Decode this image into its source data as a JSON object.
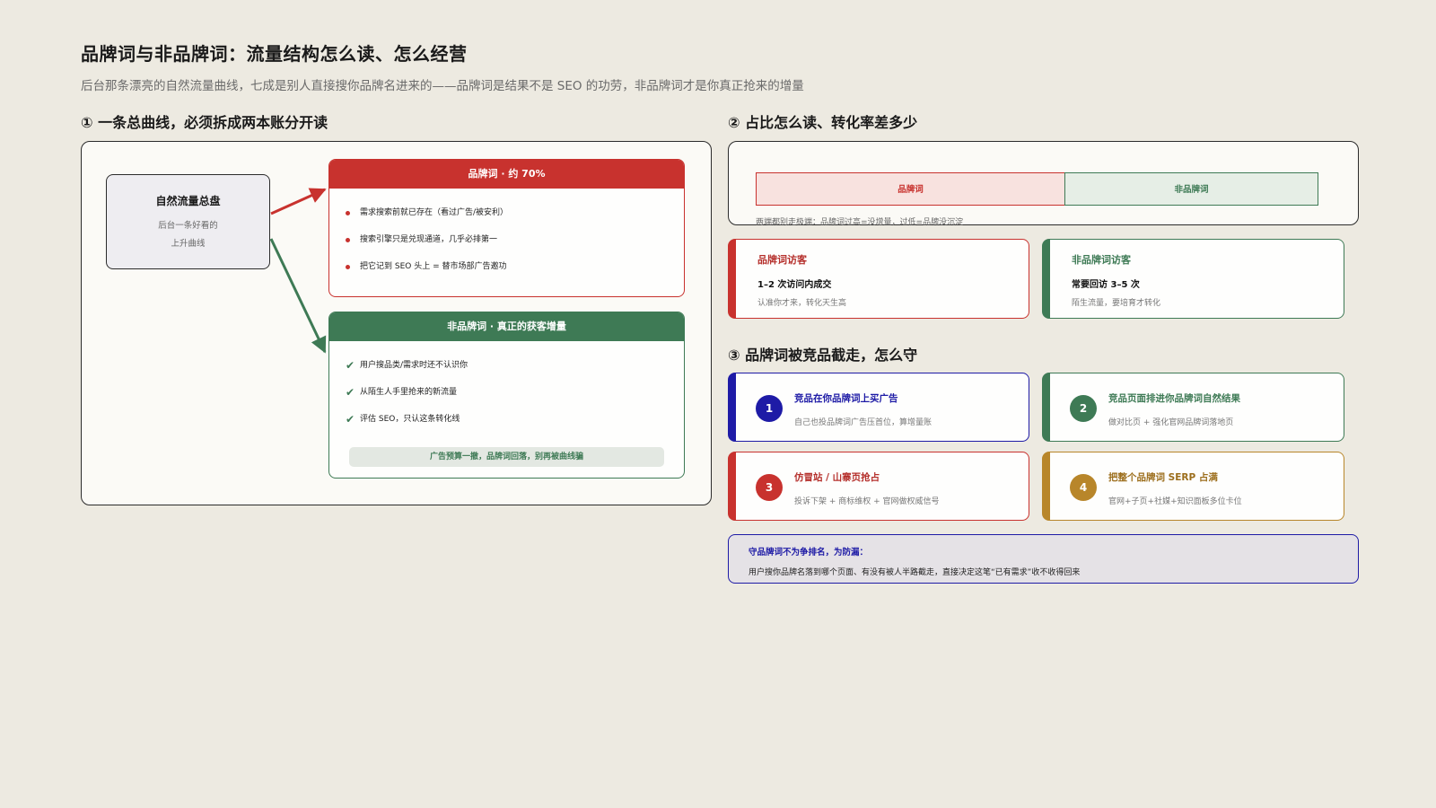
{
  "header": {
    "title": "品牌词与非品牌词：流量结构怎么读、怎么经营",
    "subtitle": "后台那条漂亮的自然流量曲线，七成是别人直接搜你品牌名进来的——品牌词是结果不是 SEO 的功劳，非品牌词才是你真正抢来的增量"
  },
  "section1": {
    "title": "① 一条总曲线，必须拆成两本账分开读",
    "source": {
      "title": "自然流量总盘",
      "line1": "后台一条好看的",
      "line2": "上升曲线"
    },
    "brand": {
      "header": "品牌词 · 约 70%",
      "items": [
        "需求搜索前就已存在（看过广告/被安利）",
        "搜索引擎只是兑现通道，几乎必排第一",
        "把它记到 SEO 头上 = 替市场部广告邀功"
      ]
    },
    "nonbrand": {
      "header": "非品牌词 · 真正的获客增量",
      "items": [
        "用户搜品类/需求时还不认识你",
        "从陌生人手里抢来的新流量",
        "评估 SEO，只认这条转化线"
      ],
      "note": "广告预算一撤，品牌词回落，别再被曲线骗"
    },
    "colors": {
      "brand": "#C8322E",
      "nonbrand": "#3E7A55"
    }
  },
  "section2": {
    "title": "② 占比怎么读、转化率差多少",
    "ratio": {
      "brand_label": "品牌词",
      "nonbrand_label": "非品牌词",
      "note": "两端都别走极端：品牌词过高=没增量，过低=品牌没沉淀"
    },
    "brand_card": {
      "title": "品牌词访客",
      "main": "1–2 次访问内成交",
      "desc": "认准你才来，转化天生高"
    },
    "nonbrand_card": {
      "title": "非品牌词访客",
      "main": "常要回访 3–5 次",
      "desc": "陌生流量，要培育才转化"
    }
  },
  "section3": {
    "title": "③ 品牌词被竞品截走，怎么守",
    "cards": [
      {
        "num": "1",
        "title": "竞品在你品牌词上买广告",
        "desc": "自己也投品牌词广告压首位，算增量账"
      },
      {
        "num": "2",
        "title": "竞品页面排进你品牌词自然结果",
        "desc": "做对比页 + 强化官网品牌词落地页"
      },
      {
        "num": "3",
        "title": "仿冒站 / 山寨页抢占",
        "desc": "投诉下架 + 商标维权 + 官网做权威信号"
      },
      {
        "num": "4",
        "title": "把整个品牌词 SERP 占满",
        "desc": "官网+子页+社媒+知识面板多位卡位"
      }
    ],
    "summary": {
      "title": "守品牌词不为争排名，为防漏：",
      "text": "用户搜你品牌名落到哪个页面、有没有被人半路截走，直接决定这笔“已有需求”收不收得回来"
    }
  }
}
